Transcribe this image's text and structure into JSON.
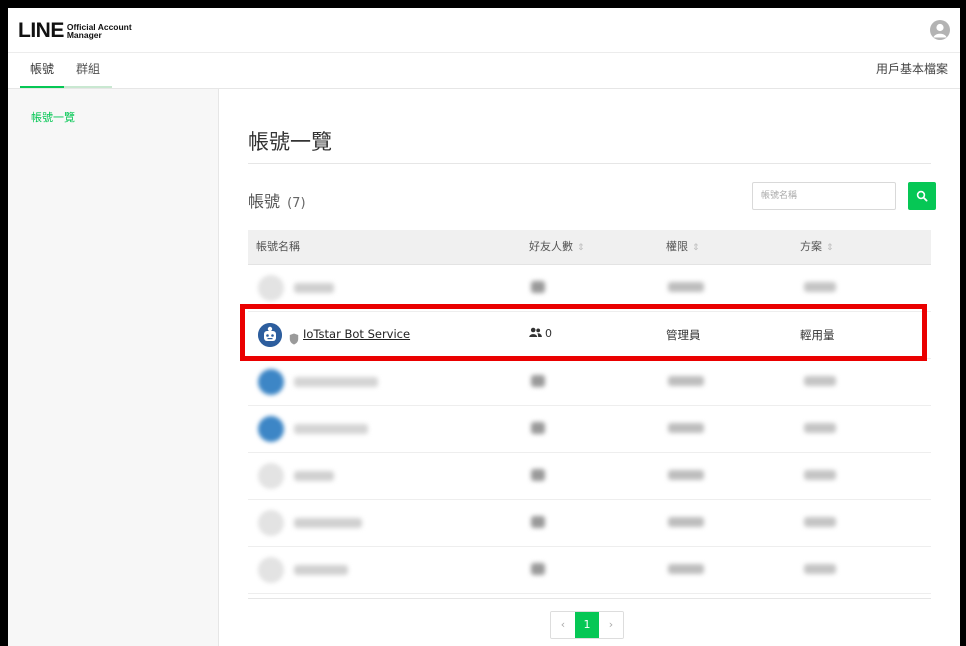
{
  "header": {
    "logo_main": "LINE",
    "logo_sub_line1": "Official Account",
    "logo_sub_line2": "Manager"
  },
  "nav": {
    "tabs": [
      {
        "label": "帳號",
        "active": true
      },
      {
        "label": "群組",
        "active": false
      }
    ],
    "profile_link": "用戶基本檔案"
  },
  "sidebar": {
    "items": [
      {
        "label": "帳號一覽",
        "active": true
      }
    ]
  },
  "main": {
    "page_title": "帳號一覽",
    "section_title": "帳號",
    "section_count": "(7)",
    "search": {
      "placeholder": "帳號名稱",
      "value": ""
    }
  },
  "table": {
    "columns": [
      {
        "label": "帳號名稱",
        "sortable": false
      },
      {
        "label": "好友人數",
        "sortable": true
      },
      {
        "label": "權限",
        "sortable": true
      },
      {
        "label": "方案",
        "sortable": true
      }
    ],
    "highlighted_row": {
      "name": "IoTstar Bot Service",
      "friends": "0",
      "role": "管理員",
      "plan": "輕用量"
    },
    "row_count": 7
  },
  "pagination": {
    "prev": "‹",
    "current": "1",
    "next": "›"
  },
  "colors": {
    "accent": "#06c755",
    "highlight": "#ea0000"
  }
}
